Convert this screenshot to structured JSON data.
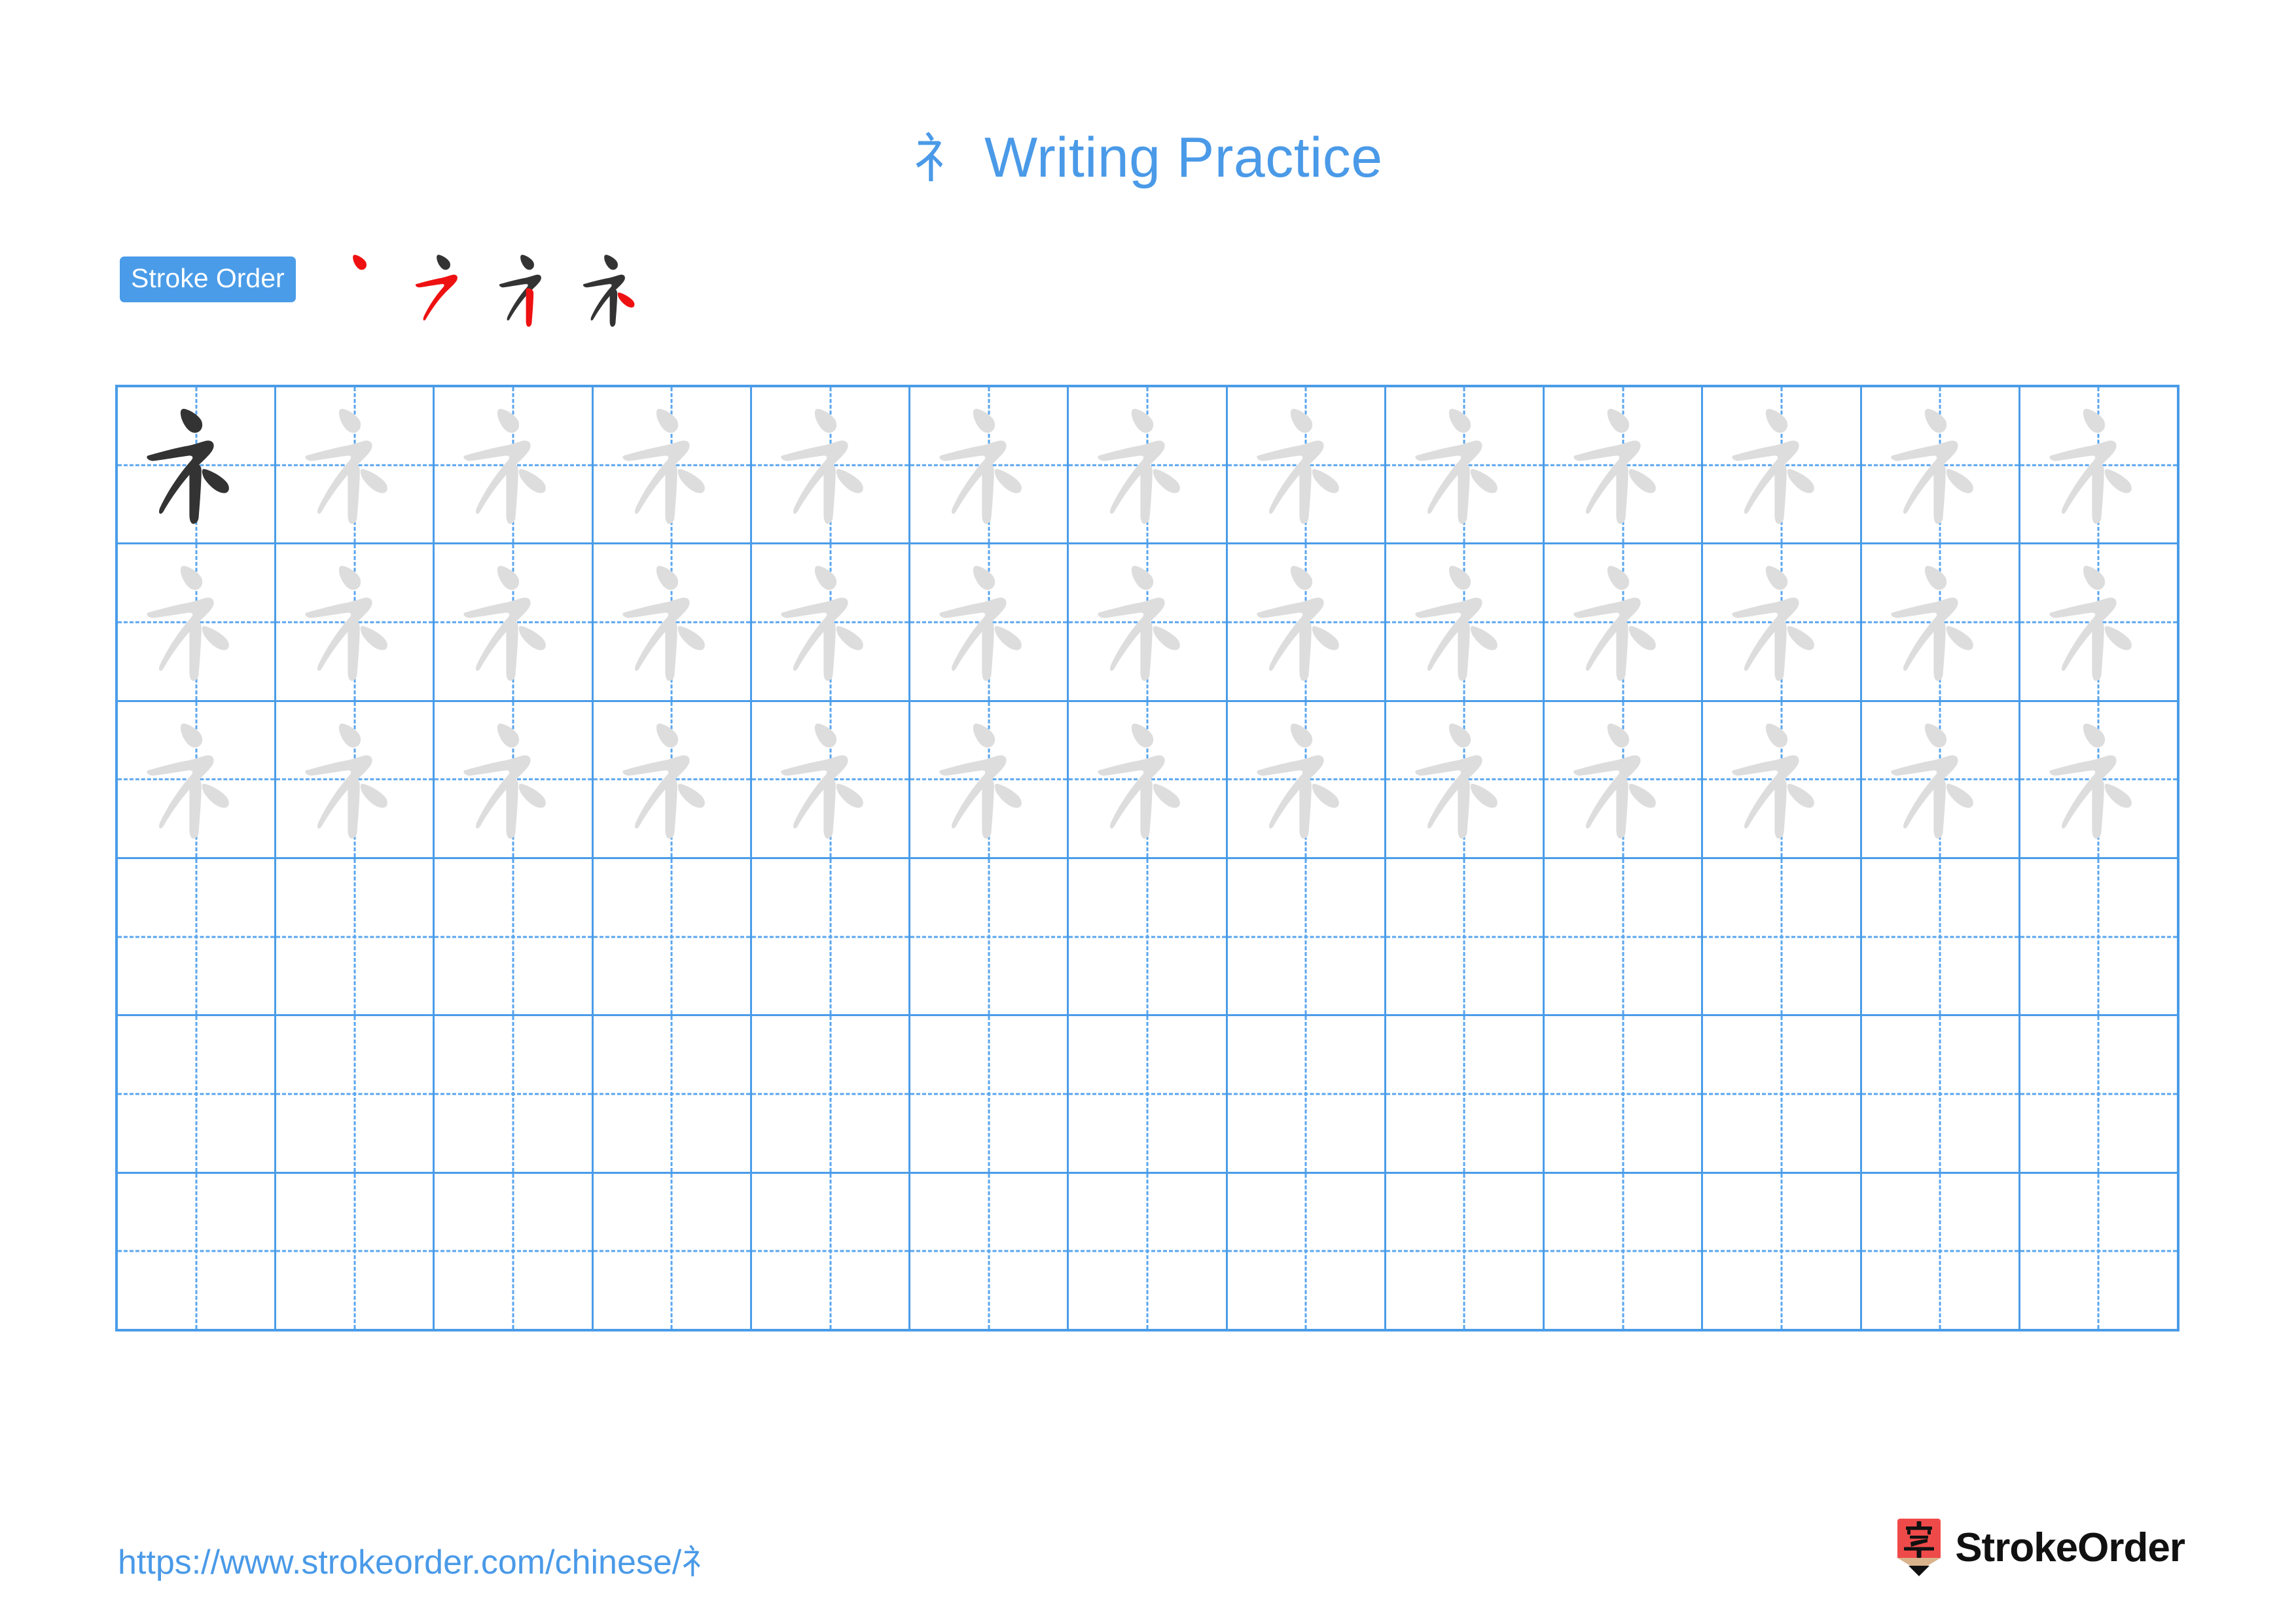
{
  "character": "礻",
  "title": {
    "character": "礻",
    "text": "Writing Practice",
    "color": "#4a9ae8"
  },
  "stroke_order": {
    "badge_label": "Stroke Order",
    "badge_bg": "#4a9ce8",
    "badge_text_color": "#ffffff",
    "active_stroke_color": "#ee1111",
    "drawn_stroke_color": "#333333",
    "step_count": 4,
    "steps": [
      {
        "index": 1,
        "strokes_drawn": 1,
        "new_stroke": "dot"
      },
      {
        "index": 2,
        "strokes_drawn": 2,
        "new_stroke": "horizontal-throw"
      },
      {
        "index": 3,
        "strokes_drawn": 3,
        "new_stroke": "vertical"
      },
      {
        "index": 4,
        "strokes_drawn": 4,
        "new_stroke": "short-right-dot"
      }
    ]
  },
  "grid": {
    "columns": 13,
    "rows": 6,
    "line_color": "#4a9ce8",
    "guide_color": "#5aa6ef",
    "model_glyph_color": "#333333",
    "trace_glyph_color": "#dddddd",
    "filled_row_count": 3,
    "empty_row_count": 3,
    "rows_content": [
      [
        "model",
        "trace",
        "trace",
        "trace",
        "trace",
        "trace",
        "trace",
        "trace",
        "trace",
        "trace",
        "trace",
        "trace",
        "trace"
      ],
      [
        "trace",
        "trace",
        "trace",
        "trace",
        "trace",
        "trace",
        "trace",
        "trace",
        "trace",
        "trace",
        "trace",
        "trace",
        "trace"
      ],
      [
        "trace",
        "trace",
        "trace",
        "trace",
        "trace",
        "trace",
        "trace",
        "trace",
        "trace",
        "trace",
        "trace",
        "trace",
        "trace"
      ],
      [
        "empty",
        "empty",
        "empty",
        "empty",
        "empty",
        "empty",
        "empty",
        "empty",
        "empty",
        "empty",
        "empty",
        "empty",
        "empty"
      ],
      [
        "empty",
        "empty",
        "empty",
        "empty",
        "empty",
        "empty",
        "empty",
        "empty",
        "empty",
        "empty",
        "empty",
        "empty",
        "empty"
      ],
      [
        "empty",
        "empty",
        "empty",
        "empty",
        "empty",
        "empty",
        "empty",
        "empty",
        "empty",
        "empty",
        "empty",
        "empty",
        "empty"
      ]
    ]
  },
  "footer": {
    "url": "https://www.strokeorder.com/chinese/礻",
    "url_color": "#4a9ae8",
    "logo_text": "StrokeOrder",
    "logo_char": "字",
    "logo_body_color": "#ef4a4a",
    "logo_tip_color": "#d9b38c",
    "logo_point_color": "#111111"
  }
}
